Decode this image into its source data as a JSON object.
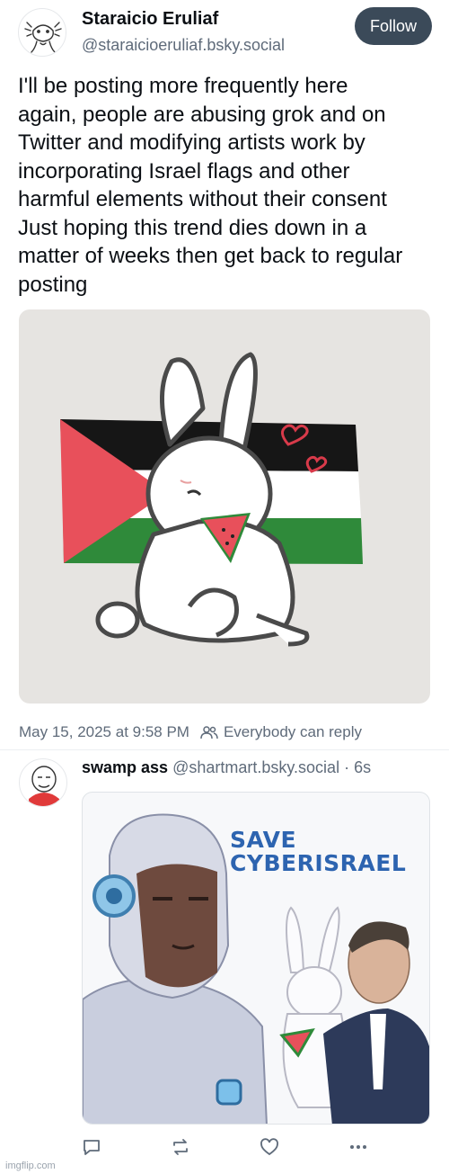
{
  "post": {
    "author": {
      "display_name": "Staraicio Eruliaf",
      "handle": "@staraicioeruliaf.bsky.social",
      "avatar_icon": "axolotl-sketch-avatar"
    },
    "follow_label": "Follow",
    "text": "I'll be posting more frequently here\nagain, people are abusing grok and on\nTwitter and modifying artists work by\nincorporating Israel flags and other\nharmful elements without their consent\nJust hoping this trend dies down in a\nmatter of weeks then get back to regular\nposting",
    "media": {
      "subject": "bunny-eating-watermelon-with-palestine-flag"
    },
    "timestamp": "May 15, 2025 at 9:58 PM",
    "reply_setting": "Everybody can reply"
  },
  "reply": {
    "author": {
      "display_name": "swamp ass",
      "handle": "@shartmart.bsky.social",
      "avatar_icon": "doodle-face-avatar"
    },
    "age": "6s",
    "separator": " · ",
    "media": {
      "subject": "cyborg-bunny-man-poster",
      "headline_lines": [
        "SAVE",
        "CYBERISRAEL"
      ]
    },
    "actions": {
      "reply_icon": "comment-icon",
      "repost_icon": "repost-icon",
      "like_icon": "heart-icon",
      "more_icon": "more-dots-icon"
    }
  },
  "watermark": "imgflip.com",
  "colors": {
    "follow_bg": "#3b4a59",
    "muted_text": "#5f6b7a",
    "flag_red": "#e8505b",
    "flag_green": "#2f8a3a",
    "poster_blue": "#2d64b0"
  }
}
